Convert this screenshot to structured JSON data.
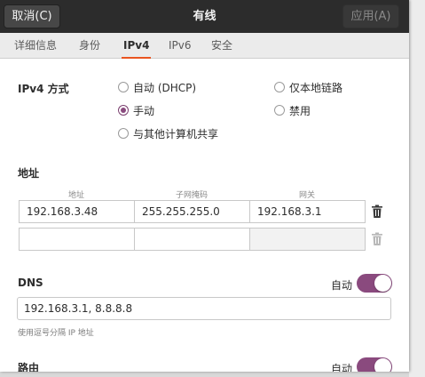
{
  "header": {
    "cancel_label": "取消(C)",
    "title": "有线",
    "apply_label": "应用(A)"
  },
  "tabs": [
    {
      "label": "详细信息",
      "active": false
    },
    {
      "label": "身份",
      "active": false
    },
    {
      "label": "IPv4",
      "active": true
    },
    {
      "label": "IPv6",
      "active": false
    },
    {
      "label": "安全",
      "active": false
    }
  ],
  "ipv4_method": {
    "label": "IPv4 方式",
    "options": [
      {
        "label": "自动 (DHCP)",
        "checked": false
      },
      {
        "label": "仅本地链路",
        "checked": false
      },
      {
        "label": "手动",
        "checked": true
      },
      {
        "label": "禁用",
        "checked": false
      },
      {
        "label": "与其他计算机共享",
        "checked": false
      }
    ]
  },
  "addresses": {
    "section_label": "地址",
    "columns": [
      "地址",
      "子网掩码",
      "网关"
    ],
    "rows": [
      [
        "192.168.3.48",
        "255.255.255.0",
        "192.168.3.1"
      ],
      [
        "",
        "",
        ""
      ]
    ]
  },
  "dns": {
    "label": "DNS",
    "auto_label": "自动",
    "auto_on": true,
    "value": "192.168.3.1, 8.8.8.8",
    "hint": "使用逗号分隔 IP 地址"
  },
  "routes": {
    "label": "路由",
    "auto_label": "自动",
    "auto_on": true
  },
  "colors": {
    "accent_tab": "#e95420",
    "switch_on": "#8a4a7e",
    "header_bg": "#2c2c2c"
  }
}
